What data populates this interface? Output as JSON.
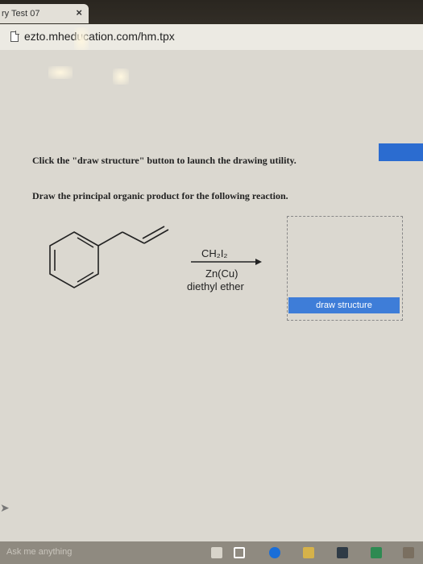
{
  "browser": {
    "tab_title": "ry Test 07",
    "tab_close": "×",
    "url": "ezto.mheducation.com/hm.tpx"
  },
  "question": {
    "instruction_1": "Click the \"draw structure\" button to launch the drawing utility.",
    "instruction_2": "Draw the principal organic product for the following reaction.",
    "reagent_top": "CH₂I₂",
    "reagent_mid": "Zn(Cu)",
    "reagent_bottom": "diethyl ether",
    "draw_button": "draw structure"
  },
  "taskbar": {
    "search_placeholder": "Ask me anything"
  },
  "colors": {
    "accent_blue": "#3e7dd8",
    "page_bg": "#dbd8d0"
  }
}
